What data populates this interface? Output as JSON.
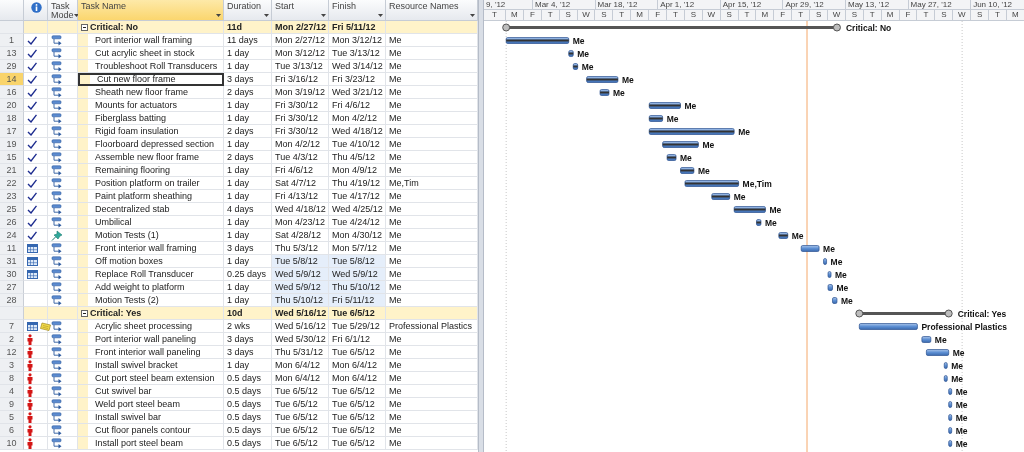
{
  "table": {
    "columns": [
      {
        "kind": "id",
        "selected": false
      },
      {
        "kind": "info",
        "selected": false
      },
      {
        "kind": "text",
        "label": "Task Mode",
        "selected": false
      },
      {
        "kind": "text",
        "label": "Task Name",
        "selected": true
      },
      {
        "kind": "text",
        "label": "Duration",
        "selected": false
      },
      {
        "kind": "text",
        "label": "Start",
        "selected": false
      },
      {
        "kind": "text",
        "label": "Finish",
        "selected": false
      },
      {
        "kind": "text",
        "label": "Resource Names",
        "selected": false
      }
    ],
    "groups": [
      {
        "label": "Critical: No",
        "duration": "11d",
        "start": "Mon 2/27/12",
        "finish": "Fri 5/11/12",
        "expanded": true,
        "bar_label": "Critical: No",
        "rows": [
          {
            "id": "1",
            "indicators": [
              {
                "kind": "complete"
              }
            ],
            "manually_scheduled": false,
            "name": "Port interior wall framing",
            "duration": "11 days",
            "start": "Mon 2/27/12",
            "finish": "Mon 3/12/12",
            "resources": "Me",
            "selected": false,
            "changed": false,
            "bar_label": "Me"
          },
          {
            "id": "13",
            "indicators": [
              {
                "kind": "complete"
              }
            ],
            "manually_scheduled": false,
            "name": "Cut acrylic sheet in stock",
            "duration": "1 day",
            "start": "Mon 3/12/12",
            "finish": "Tue 3/13/12",
            "resources": "Me",
            "selected": false,
            "changed": false,
            "bar_label": "Me"
          },
          {
            "id": "29",
            "indicators": [
              {
                "kind": "complete"
              }
            ],
            "manually_scheduled": false,
            "name": "Troubleshoot Roll Transducers",
            "duration": "1 day",
            "start": "Tue 3/13/12",
            "finish": "Wed 3/14/12",
            "resources": "Me",
            "selected": false,
            "changed": false,
            "bar_label": "Me"
          },
          {
            "id": "14",
            "indicators": [
              {
                "kind": "complete"
              }
            ],
            "manually_scheduled": false,
            "name": "Cut new floor frame",
            "duration": "3 days",
            "start": "Fri 3/16/12",
            "finish": "Fri 3/23/12",
            "resources": "Me",
            "selected": true,
            "changed": false,
            "bar_label": "Me"
          },
          {
            "id": "16",
            "indicators": [
              {
                "kind": "complete"
              }
            ],
            "manually_scheduled": false,
            "name": "Sheath new floor frame",
            "duration": "2 days",
            "start": "Mon 3/19/12",
            "finish": "Wed 3/21/12",
            "resources": "Me",
            "selected": false,
            "changed": false,
            "bar_label": "Me"
          },
          {
            "id": "20",
            "indicators": [
              {
                "kind": "complete"
              }
            ],
            "manually_scheduled": false,
            "name": "Mounts for actuators",
            "duration": "1 day",
            "start": "Fri 3/30/12",
            "finish": "Fri 4/6/12",
            "resources": "Me",
            "selected": false,
            "changed": false,
            "bar_label": "Me"
          },
          {
            "id": "18",
            "indicators": [
              {
                "kind": "complete"
              }
            ],
            "manually_scheduled": false,
            "name": "Fiberglass batting",
            "duration": "1 day",
            "start": "Fri 3/30/12",
            "finish": "Mon 4/2/12",
            "resources": "Me",
            "selected": false,
            "changed": false,
            "bar_label": "Me"
          },
          {
            "id": "17",
            "indicators": [
              {
                "kind": "complete"
              }
            ],
            "manually_scheduled": false,
            "name": "Rigid foam insulation",
            "duration": "2 days",
            "start": "Fri 3/30/12",
            "finish": "Wed 4/18/12",
            "resources": "Me",
            "selected": false,
            "changed": false,
            "bar_label": "Me"
          },
          {
            "id": "19",
            "indicators": [
              {
                "kind": "complete"
              }
            ],
            "manually_scheduled": false,
            "name": "Floorboard depressed section",
            "duration": "1 day",
            "start": "Mon 4/2/12",
            "finish": "Tue 4/10/12",
            "resources": "Me",
            "selected": false,
            "changed": false,
            "bar_label": "Me"
          },
          {
            "id": "15",
            "indicators": [
              {
                "kind": "complete"
              }
            ],
            "manually_scheduled": false,
            "name": "Assemble new floor frame",
            "duration": "2 days",
            "start": "Tue 4/3/12",
            "finish": "Thu 4/5/12",
            "resources": "Me",
            "selected": false,
            "changed": false,
            "bar_label": "Me"
          },
          {
            "id": "21",
            "indicators": [
              {
                "kind": "complete"
              }
            ],
            "manually_scheduled": false,
            "name": "Remaining flooring",
            "duration": "1 day",
            "start": "Fri 4/6/12",
            "finish": "Mon 4/9/12",
            "resources": "Me",
            "selected": false,
            "changed": false,
            "bar_label": "Me"
          },
          {
            "id": "22",
            "indicators": [
              {
                "kind": "complete"
              }
            ],
            "manually_scheduled": false,
            "name": "Position platform on trailer",
            "duration": "1 day",
            "start": "Sat 4/7/12",
            "finish": "Thu 4/19/12",
            "resources": "Me,Tim",
            "selected": false,
            "changed": false,
            "bar_label": "Me,Tim"
          },
          {
            "id": "23",
            "indicators": [
              {
                "kind": "complete"
              }
            ],
            "manually_scheduled": false,
            "name": "Paint platform sheathing",
            "duration": "1 day",
            "start": "Fri 4/13/12",
            "finish": "Tue 4/17/12",
            "resources": "Me",
            "selected": false,
            "changed": false,
            "bar_label": "Me"
          },
          {
            "id": "25",
            "indicators": [
              {
                "kind": "complete"
              }
            ],
            "manually_scheduled": false,
            "name": "Decentralized stab",
            "duration": "4 days",
            "start": "Wed 4/18/12",
            "finish": "Wed 4/25/12",
            "resources": "Me",
            "selected": false,
            "changed": false,
            "bar_label": "Me"
          },
          {
            "id": "26",
            "indicators": [
              {
                "kind": "complete"
              }
            ],
            "manually_scheduled": false,
            "name": "Umbilical",
            "duration": "1 day",
            "start": "Mon 4/23/12",
            "finish": "Tue 4/24/12",
            "resources": "Me",
            "selected": false,
            "changed": false,
            "bar_label": "Me"
          },
          {
            "id": "24",
            "indicators": [
              {
                "kind": "complete"
              }
            ],
            "manually_scheduled": true,
            "name": "Motion Tests (1)",
            "duration": "1 day",
            "start": "Sat 4/28/12",
            "finish": "Mon 4/30/12",
            "resources": "Me",
            "selected": false,
            "changed": false,
            "bar_label": "Me"
          },
          {
            "id": "11",
            "indicators": [
              {
                "kind": "calendar"
              }
            ],
            "manually_scheduled": false,
            "name": "Front interior wall framing",
            "duration": "3 days",
            "start": "Thu 5/3/12",
            "finish": "Mon 5/7/12",
            "resources": "Me",
            "selected": false,
            "changed": false,
            "bar_label": "Me"
          },
          {
            "id": "31",
            "indicators": [
              {
                "kind": "calendar"
              }
            ],
            "manually_scheduled": false,
            "name": "Off motion boxes",
            "duration": "1 day",
            "start": "Tue 5/8/12",
            "finish": "Tue 5/8/12",
            "resources": "Me",
            "selected": false,
            "changed": true,
            "bar_label": "Me"
          },
          {
            "id": "30",
            "indicators": [
              {
                "kind": "calendar"
              }
            ],
            "manually_scheduled": false,
            "name": "Replace Roll Transducer",
            "duration": "0.25 days",
            "start": "Wed 5/9/12",
            "finish": "Wed 5/9/12",
            "resources": "Me",
            "selected": false,
            "changed": true,
            "bar_label": "Me"
          },
          {
            "id": "27",
            "manually_scheduled": false,
            "name": "Add weight to platform",
            "duration": "1 day",
            "start": "Wed 5/9/12",
            "finish": "Thu 5/10/12",
            "resources": "Me",
            "selected": false,
            "changed": true,
            "bar_label": "Me"
          },
          {
            "id": "28",
            "manually_scheduled": false,
            "name": "Motion Tests (2)",
            "duration": "1 day",
            "start": "Thu 5/10/12",
            "finish": "Fri 5/11/12",
            "resources": "Me",
            "selected": false,
            "changed": true,
            "bar_label": "Me"
          }
        ]
      },
      {
        "label": "Critical: Yes",
        "duration": "10d",
        "start": "Wed 5/16/12",
        "finish": "Tue 6/5/12",
        "expanded": true,
        "bar_label": "Critical: Yes",
        "rows": [
          {
            "id": "7",
            "indicators": [
              {
                "kind": "calendar"
              },
              {
                "kind": "note"
              }
            ],
            "manually_scheduled": false,
            "name": "Acrylic sheet processing",
            "duration": "2 wks",
            "start": "Wed 5/16/12",
            "finish": "Tue 5/29/12",
            "resources": "Professional Plastics",
            "selected": false,
            "changed": false,
            "bar_label": "Professional Plastics"
          },
          {
            "id": "2",
            "indicators": [
              {
                "kind": "person"
              }
            ],
            "manually_scheduled": false,
            "name": "Port interior wall paneling",
            "duration": "3 days",
            "start": "Wed 5/30/12",
            "finish": "Fri 6/1/12",
            "resources": "Me",
            "selected": false,
            "changed": false,
            "bar_label": "Me"
          },
          {
            "id": "12",
            "indicators": [
              {
                "kind": "person"
              }
            ],
            "manually_scheduled": false,
            "name": "Front interior wall paneling",
            "duration": "3 days",
            "start": "Thu 5/31/12",
            "finish": "Tue 6/5/12",
            "resources": "Me",
            "selected": false,
            "changed": false,
            "bar_label": "Me"
          },
          {
            "id": "3",
            "indicators": [
              {
                "kind": "person"
              }
            ],
            "manually_scheduled": false,
            "name": "Install swivel bracket",
            "duration": "1 day",
            "start": "Mon 6/4/12",
            "finish": "Mon 6/4/12",
            "resources": "Me",
            "selected": false,
            "changed": false,
            "bar_label": "Me"
          },
          {
            "id": "8",
            "indicators": [
              {
                "kind": "person"
              }
            ],
            "manually_scheduled": false,
            "name": "Cut port steel beam extension",
            "duration": "0.5 days",
            "start": "Mon 6/4/12",
            "finish": "Mon 6/4/12",
            "resources": "Me",
            "selected": false,
            "changed": false,
            "bar_label": "Me"
          },
          {
            "id": "4",
            "indicators": [
              {
                "kind": "person"
              }
            ],
            "manually_scheduled": false,
            "name": "Cut swivel bar",
            "duration": "0.5 days",
            "start": "Tue 6/5/12",
            "finish": "Tue 6/5/12",
            "resources": "Me",
            "selected": false,
            "changed": false,
            "bar_label": "Me"
          },
          {
            "id": "9",
            "indicators": [
              {
                "kind": "person"
              }
            ],
            "manually_scheduled": false,
            "name": "Weld port steel beam",
            "duration": "0.5 days",
            "start": "Tue 6/5/12",
            "finish": "Tue 6/5/12",
            "resources": "Me",
            "selected": false,
            "changed": false,
            "bar_label": "Me"
          },
          {
            "id": "5",
            "indicators": [
              {
                "kind": "person"
              }
            ],
            "manually_scheduled": false,
            "name": "Install swivel bar",
            "duration": "0.5 days",
            "start": "Tue 6/5/12",
            "finish": "Tue 6/5/12",
            "resources": "Me",
            "selected": false,
            "changed": false,
            "bar_label": "Me"
          },
          {
            "id": "6",
            "indicators": [
              {
                "kind": "person"
              }
            ],
            "manually_scheduled": false,
            "name": "Cut floor panels contour",
            "duration": "0.5 days",
            "start": "Tue 6/5/12",
            "finish": "Tue 6/5/12",
            "resources": "Me",
            "selected": false,
            "changed": false,
            "bar_label": "Me"
          },
          {
            "id": "10",
            "indicators": [
              {
                "kind": "person"
              }
            ],
            "manually_scheduled": false,
            "name": "Install port steel beam",
            "duration": "0.5 days",
            "start": "Tue 6/5/12",
            "finish": "Tue 6/5/12",
            "resources": "Me",
            "selected": false,
            "changed": false,
            "bar_label": "Me"
          }
        ]
      }
    ]
  },
  "timescale": {
    "major": [
      "9, '12",
      "Mar 4, '12",
      "Mar 18, '12",
      "Apr 1, '12",
      "Apr 15, '12",
      "Apr 29, '12",
      "May 13, '12",
      "May 27, '12",
      "Jun 10, '12"
    ],
    "minor": [
      "T",
      "M",
      "F",
      "T",
      "S",
      "W",
      "S",
      "T",
      "M",
      "F",
      "T",
      "S",
      "W",
      "S",
      "T",
      "M",
      "F",
      "T",
      "S",
      "W",
      "S",
      "T",
      "M",
      "F",
      "T",
      "S",
      "W",
      "S",
      "T",
      "M"
    ]
  }
}
